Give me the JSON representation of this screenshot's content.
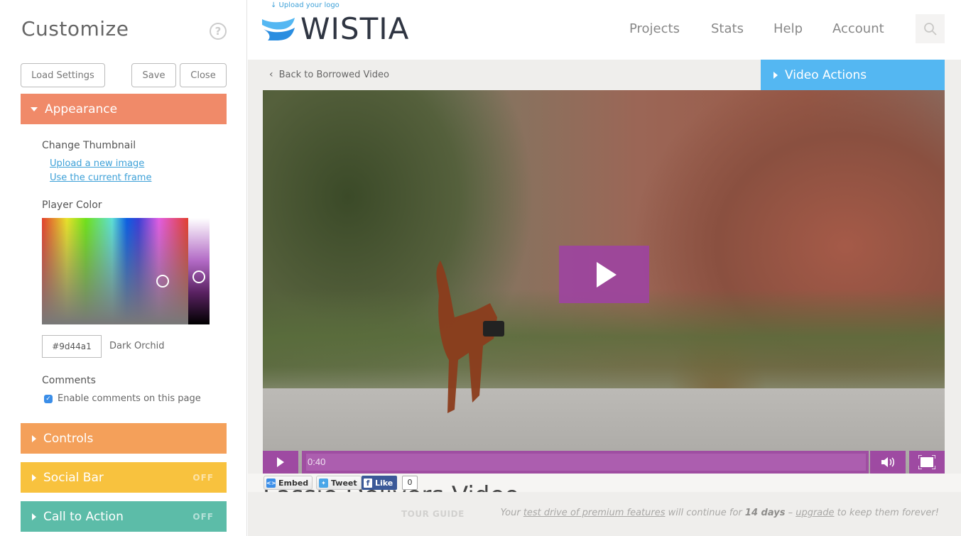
{
  "sidebar": {
    "title": "Customize",
    "help_icon": "question-circle-icon",
    "buttons": {
      "load": "Load Settings",
      "save": "Save",
      "close": "Close"
    },
    "sections": [
      {
        "label": "Appearance",
        "expanded": true,
        "color": "#f08a69",
        "status": ""
      },
      {
        "label": "Controls",
        "expanded": false,
        "color": "#f4a05a",
        "status": ""
      },
      {
        "label": "Social Bar",
        "expanded": false,
        "color": "#f8c23e",
        "status": "OFF"
      },
      {
        "label": "Call to Action",
        "expanded": false,
        "color": "#5cbca8",
        "status": "OFF"
      }
    ],
    "appearance": {
      "thumbnail_label": "Change Thumbnail",
      "upload_link": "Upload a new image",
      "current_frame_link": "Use the current frame",
      "player_color_label": "Player Color",
      "hex_value": "#9d44a1",
      "color_name": "Dark Orchid",
      "comments_label": "Comments",
      "comments_checkbox_label": "Enable comments on this page",
      "comments_enabled": true
    }
  },
  "header": {
    "upload_logo": "↓ Upload your logo",
    "logo_text": "WISTIA",
    "nav": [
      "Projects",
      "Stats",
      "Help",
      "Account"
    ],
    "search_icon": "search-icon"
  },
  "media": {
    "back_link": "Back to Borrowed Video",
    "video_actions": "Video Actions",
    "player_color": "#9d44a1",
    "current_time": "0:40",
    "social": {
      "embed": "Embed",
      "tweet": "Tweet",
      "like": "Like",
      "like_count": "0"
    }
  },
  "footer": {
    "tour_guide": "TOUR GUIDE",
    "trial_prefix": "Your ",
    "trial_link": "test drive of premium features",
    "trial_middle": " will continue for ",
    "trial_days": "14 days",
    "trial_dash": " – ",
    "upgrade_link": "upgrade",
    "trial_suffix": " to keep them forever!"
  }
}
